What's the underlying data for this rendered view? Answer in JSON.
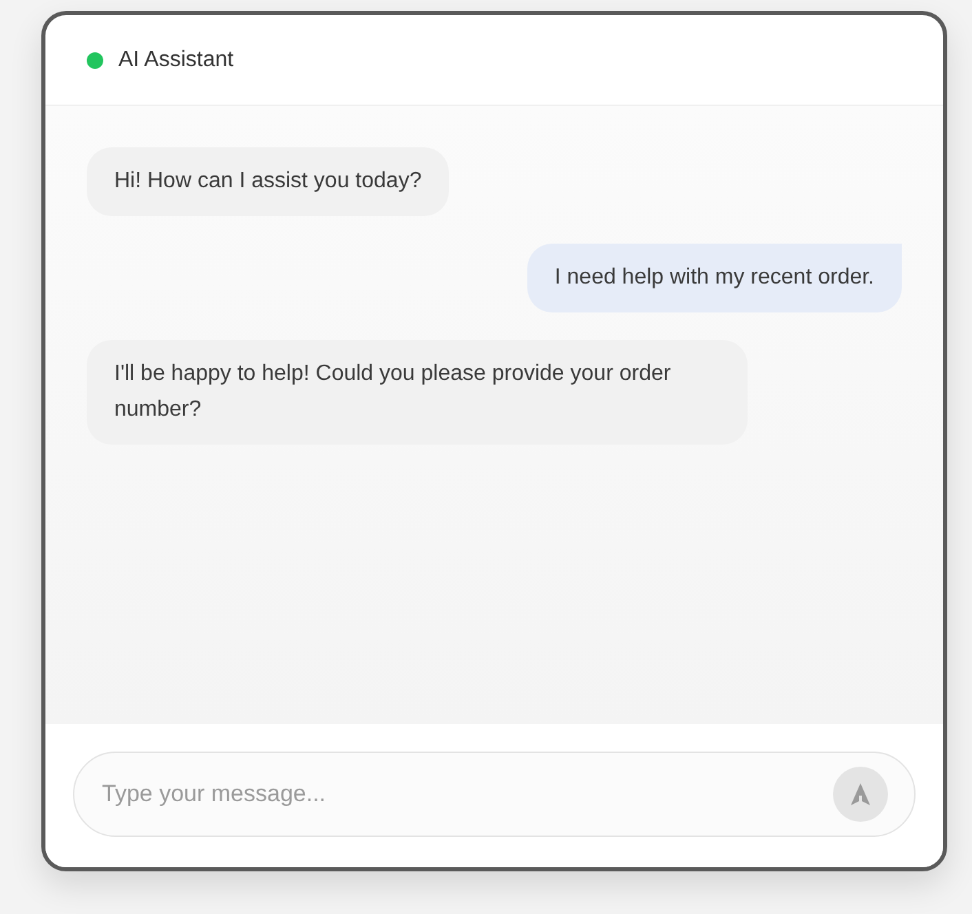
{
  "header": {
    "title": "AI Assistant",
    "online": true
  },
  "messages": [
    {
      "kind": "assistant",
      "text": "Hi! How can I assist you today?"
    },
    {
      "kind": "user",
      "text": "I need help with my recent order."
    },
    {
      "kind": "assistant",
      "text": "I'll be happy to help! Could you please provide your order number?"
    }
  ],
  "composer": {
    "placeholder": "Type your message..."
  }
}
